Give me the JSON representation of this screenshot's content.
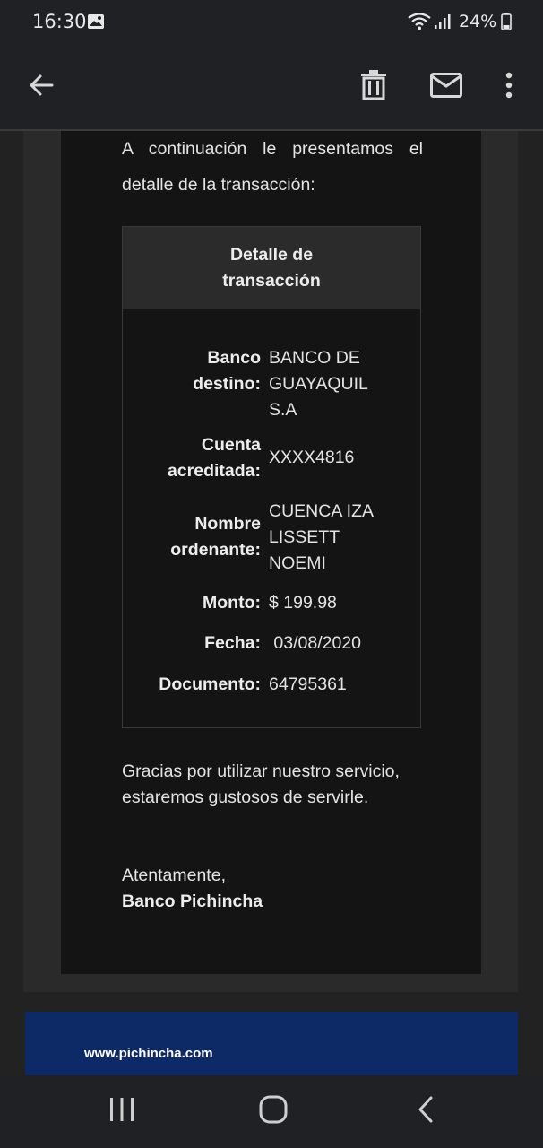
{
  "status_bar": {
    "time": "16:30",
    "battery": "24%"
  },
  "email": {
    "intro": "A continuación le presentamos el detalle de la transacción:",
    "table": {
      "header": "Detalle de transacción",
      "rows": [
        {
          "label": "Banco destino:",
          "value": "BANCO DE GUAYAQUIL S.A"
        },
        {
          "label": "Cuenta acreditada:",
          "value": "XXXX4816"
        },
        {
          "label": "Nombre ordenante:",
          "value": "CUENCA IZA LISSETT NOEMI"
        },
        {
          "label": "Monto:",
          "value": "$ 199.98"
        },
        {
          "label": "Fecha:",
          "value": " 03/08/2020"
        },
        {
          "label": "Documento:",
          "value": "64795361"
        }
      ]
    },
    "thanks": "Gracias por utilizar nuestro servicio, estaremos gustosos de servirle.",
    "closing": "Atentamente,",
    "signature": "Banco Pichincha",
    "footer_link": "www.pichincha.com"
  },
  "icons": {
    "appbar": [
      "back-arrow-icon",
      "delete-icon",
      "mail-icon",
      "more-vert-icon"
    ],
    "navbar": [
      "recent-apps-icon",
      "home-icon",
      "back-icon"
    ]
  }
}
